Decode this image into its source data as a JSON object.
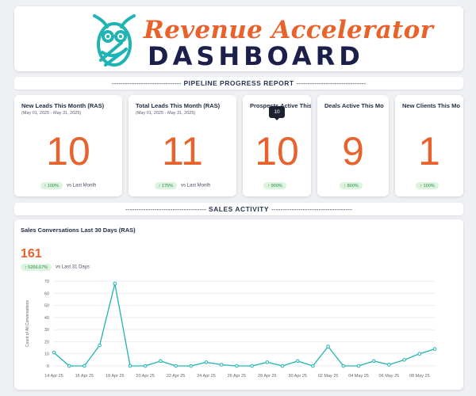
{
  "header": {
    "title_line1": "Revenue Accelerator",
    "title_line2": "DASHBOARD",
    "logo_icon": "owl-logo-icon",
    "brand_teal": "#1fb3b3",
    "brand_orange": "#e8622c",
    "brand_navy": "#1b1f4a"
  },
  "pipeline_section": {
    "title": "PIPELINE PROGRESS REPORT",
    "dashes_left": "-------------------------------",
    "dashes_right": "-------------------------------"
  },
  "kpis": [
    {
      "title": "New Leads This Month (RAS)",
      "range": "(May 01, 2025 - May 31, 2025)",
      "value": "10",
      "badge": "↑ 100%",
      "comparison": "vs Last Month"
    },
    {
      "title": "Total Leads This Month (RAS)",
      "range": "(May 01, 2025 - May 31, 2025)",
      "value": "11",
      "badge": "↑ 175%",
      "comparison": "vs Last Month"
    },
    {
      "title": "Prospects Active This",
      "range": "",
      "value": "10",
      "badge": "↑ 900%",
      "comparison": ""
    },
    {
      "title": "Deals Active This Mo",
      "range": "",
      "value": "9",
      "badge": "↑ 800%",
      "comparison": ""
    },
    {
      "title": "New Clients This Mo",
      "range": "",
      "value": "1",
      "badge": "↑ 100%",
      "comparison": ""
    }
  ],
  "tooltip": {
    "value": "10"
  },
  "sales_section": {
    "title": "SALES ACTIVITY",
    "dashes_left": "------------------------------------",
    "dashes_right": "------------------------------------"
  },
  "sales_card": {
    "title": "Sales Conversations Last 30 Days (RAS)",
    "value": "161",
    "badge": "↑ 5266.67%",
    "comparison": "vs Last 31 Days"
  },
  "chart_data": {
    "type": "line",
    "title": "",
    "ylabel": "Count of All Conversations",
    "xlabel": "",
    "ylim": [
      0,
      70
    ],
    "yticks": [
      "0",
      "10",
      "20",
      "30",
      "40",
      "50",
      "60",
      "70"
    ],
    "xtick_labels": [
      "14 Apr 25",
      "16 Apr 25",
      "18 Apr 25",
      "20 Apr 25",
      "22 Apr 25",
      "24 Apr 25",
      "26 Apr 25",
      "28 Apr 25",
      "30 Apr 25",
      "02 May 25",
      "04 May 25",
      "06 May 25",
      "08 May 25"
    ],
    "x": [
      "14 Apr 25",
      "15 Apr 25",
      "16 Apr 25",
      "17 Apr 25",
      "18 Apr 25",
      "19 Apr 25",
      "20 Apr 25",
      "21 Apr 25",
      "22 Apr 25",
      "23 Apr 25",
      "24 Apr 25",
      "25 Apr 25",
      "26 Apr 25",
      "27 Apr 25",
      "28 Apr 25",
      "29 Apr 25",
      "30 Apr 25",
      "01 May 25",
      "02 May 25",
      "03 May 25",
      "04 May 25",
      "05 May 25",
      "06 May 25",
      "07 May 25",
      "08 May 25",
      "09 May 25"
    ],
    "values": [
      11,
      0,
      0,
      17,
      68,
      0,
      0,
      4,
      0,
      0,
      3,
      1,
      0,
      0,
      3,
      0,
      4,
      0,
      16,
      0,
      0,
      4,
      1,
      5,
      10,
      14
    ],
    "line_color": "#1fb3b3",
    "grid": true
  }
}
